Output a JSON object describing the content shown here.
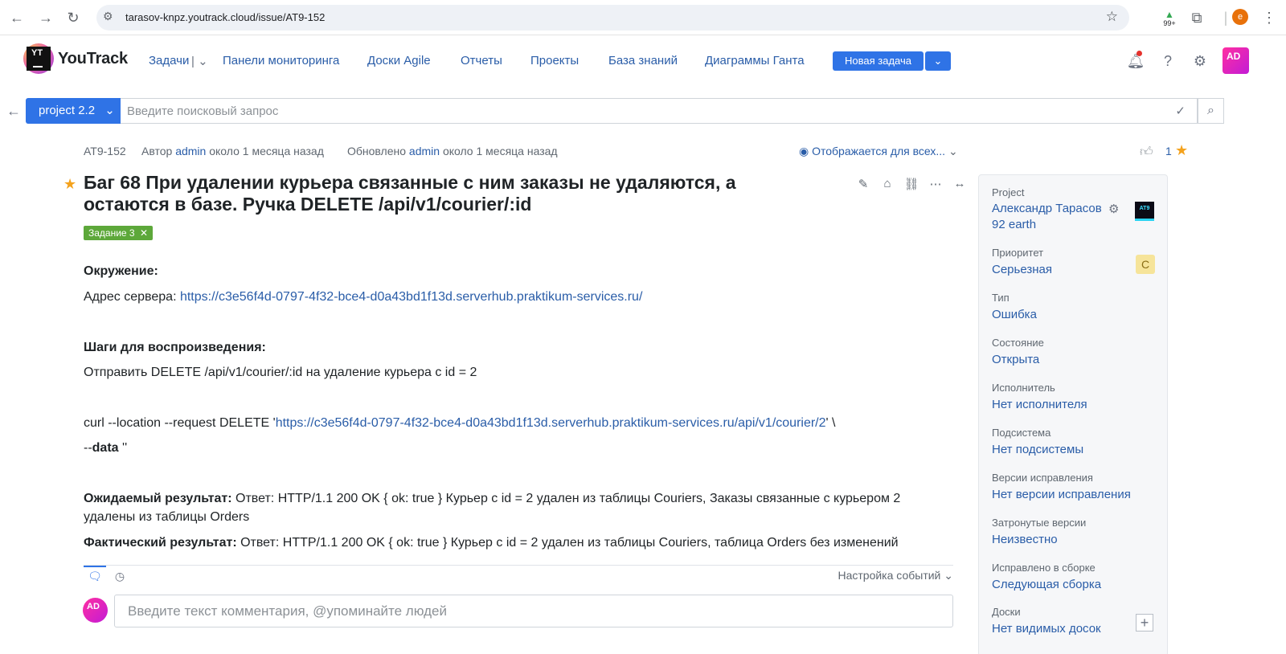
{
  "browser": {
    "url": "tarasov-knpz.youtrack.cloud/issue/AT9-152",
    "ext_badge": "99+",
    "profile_initial": "e"
  },
  "header": {
    "app_name": "YouTrack",
    "logo_text": "YT",
    "nav": [
      "Задачи",
      "Панели мониторинга",
      "Доски Agile",
      "Отчеты",
      "Проекты",
      "База знаний",
      "Диаграммы Ганта"
    ],
    "new_issue_label": "Новая задача",
    "avatar_initials": "AD"
  },
  "search": {
    "context_label": "project 2.2",
    "placeholder": "Введите поисковый запрос"
  },
  "issue": {
    "id": "AT9-152",
    "author_prefix": "Автор",
    "author": "admin",
    "created": "около 1 месяца назад",
    "updated_prefix": "Обновлено",
    "updater": "admin",
    "updated": "около 1 месяца назад",
    "visibility": "Отображается для всех...",
    "votes": "1",
    "title": "Баг 68 При удалении курьера связанные с ним заказы не удаляются, а остаются в базе. Ручка DELETE /api/v1/courier/:id",
    "tag": "Задание 3"
  },
  "description": {
    "env_heading": "Окружение:",
    "server_label": "Адрес сервера: ",
    "server_url": "https://c3e56f4d-0797-4f32-bce4-d0a43bd1f13d.serverhub.praktikum-services.ru/",
    "steps_heading": "Шаги для воспроизведения:",
    "step1": "Отправить DELETE /api/v1/courier/:id на удаление курьера с id = 2",
    "curl_prefix": "curl --location --request DELETE '",
    "curl_url": "https://c3e56f4d-0797-4f32-bce4-d0a43bd1f13d.serverhub.praktikum-services.ru/api/v1/courier/2",
    "curl_suffix": "' \\",
    "data_prefix": "--",
    "data_keyword": "data",
    "data_suffix": " ''",
    "expected_label": "Ожидаемый результат:",
    "expected_text_1": " Ответ: HTTP/1.1 200 OK { ok: true } Курьер с id = 2 удален из таблицы Couriers, Заказы связанные с курьером 2",
    "expected_text_2": "удалены из таблицы Orders",
    "actual_label": "Фактический результат:",
    "actual_text": " Ответ: HTTP/1.1 200 OK { ok: true } Курьер с id = 2 удален из таблицы Couriers, таблица Orders без изменений"
  },
  "activity": {
    "event_settings": "Настройка событий",
    "comment_placeholder": "Введите текст комментария, @упоминайте людей",
    "avatar_initials": "AD"
  },
  "sidebar": {
    "project_label": "Project",
    "project_value_1": "Александр Тарасов",
    "project_value_2": "92 earth",
    "project_logo": "AT9",
    "priority_label": "Приоритет",
    "priority_value": "Серьезная",
    "priority_badge": "C",
    "type_label": "Тип",
    "type_value": "Ошибка",
    "state_label": "Состояние",
    "state_value": "Открыта",
    "assignee_label": "Исполнитель",
    "assignee_value": "Нет исполнителя",
    "subsystem_label": "Подсистема",
    "subsystem_value": "Нет подсистемы",
    "fix_versions_label": "Версии исправления",
    "fix_versions_value": "Нет версии исправления",
    "affected_label": "Затронутые версии",
    "affected_value": "Неизвестно",
    "fixed_build_label": "Исправлено в сборке",
    "fixed_build_value": "Следующая сборка",
    "boards_label": "Доски",
    "boards_value": "Нет видимых досок"
  }
}
